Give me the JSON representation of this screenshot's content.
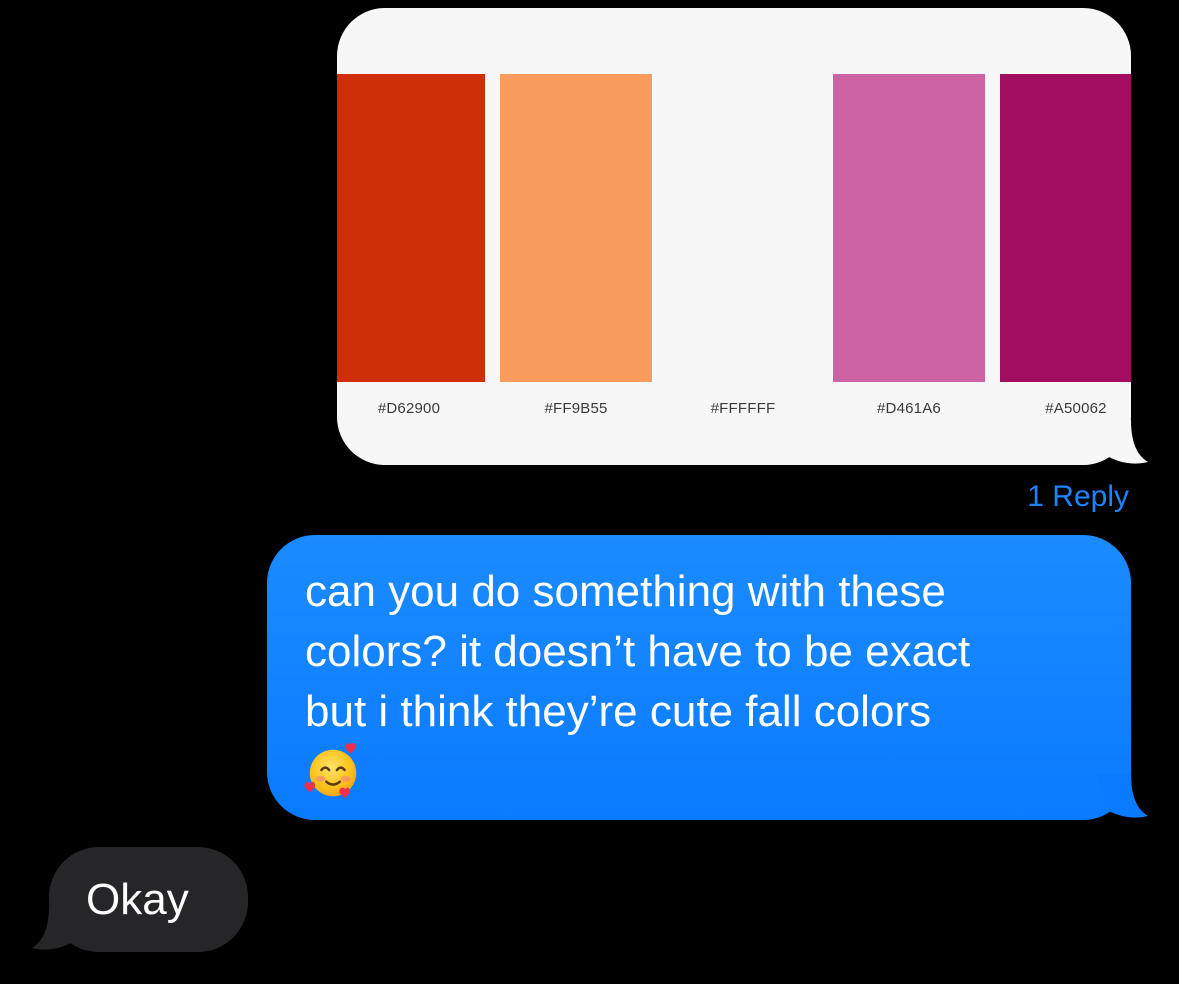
{
  "thread": {
    "image_message": {
      "swatches": [
        {
          "code": "#D62900",
          "color": "#cc2e08"
        },
        {
          "code": "#FF9B55",
          "color": "#f89c5c"
        },
        {
          "code": "#FFFFFF",
          "color": "#f7f7f7"
        },
        {
          "code": "#D461A6",
          "color": "#cd62a5"
        },
        {
          "code": "#A50062",
          "color": "#a20d60"
        }
      ]
    },
    "reply_count_label": "1 Reply",
    "outgoing_message": {
      "text": "can you do something with these\ncolors? it doesn’t have to be exact\nbut i think they’re cute fall colors",
      "emoji": "smiling-face-with-hearts"
    },
    "incoming_message": {
      "text": "Okay"
    }
  },
  "colors": {
    "background": "#000000",
    "outgoing_bubble": "#127fff",
    "incoming_bubble": "#262628",
    "accent_link": "#1a85ff"
  }
}
